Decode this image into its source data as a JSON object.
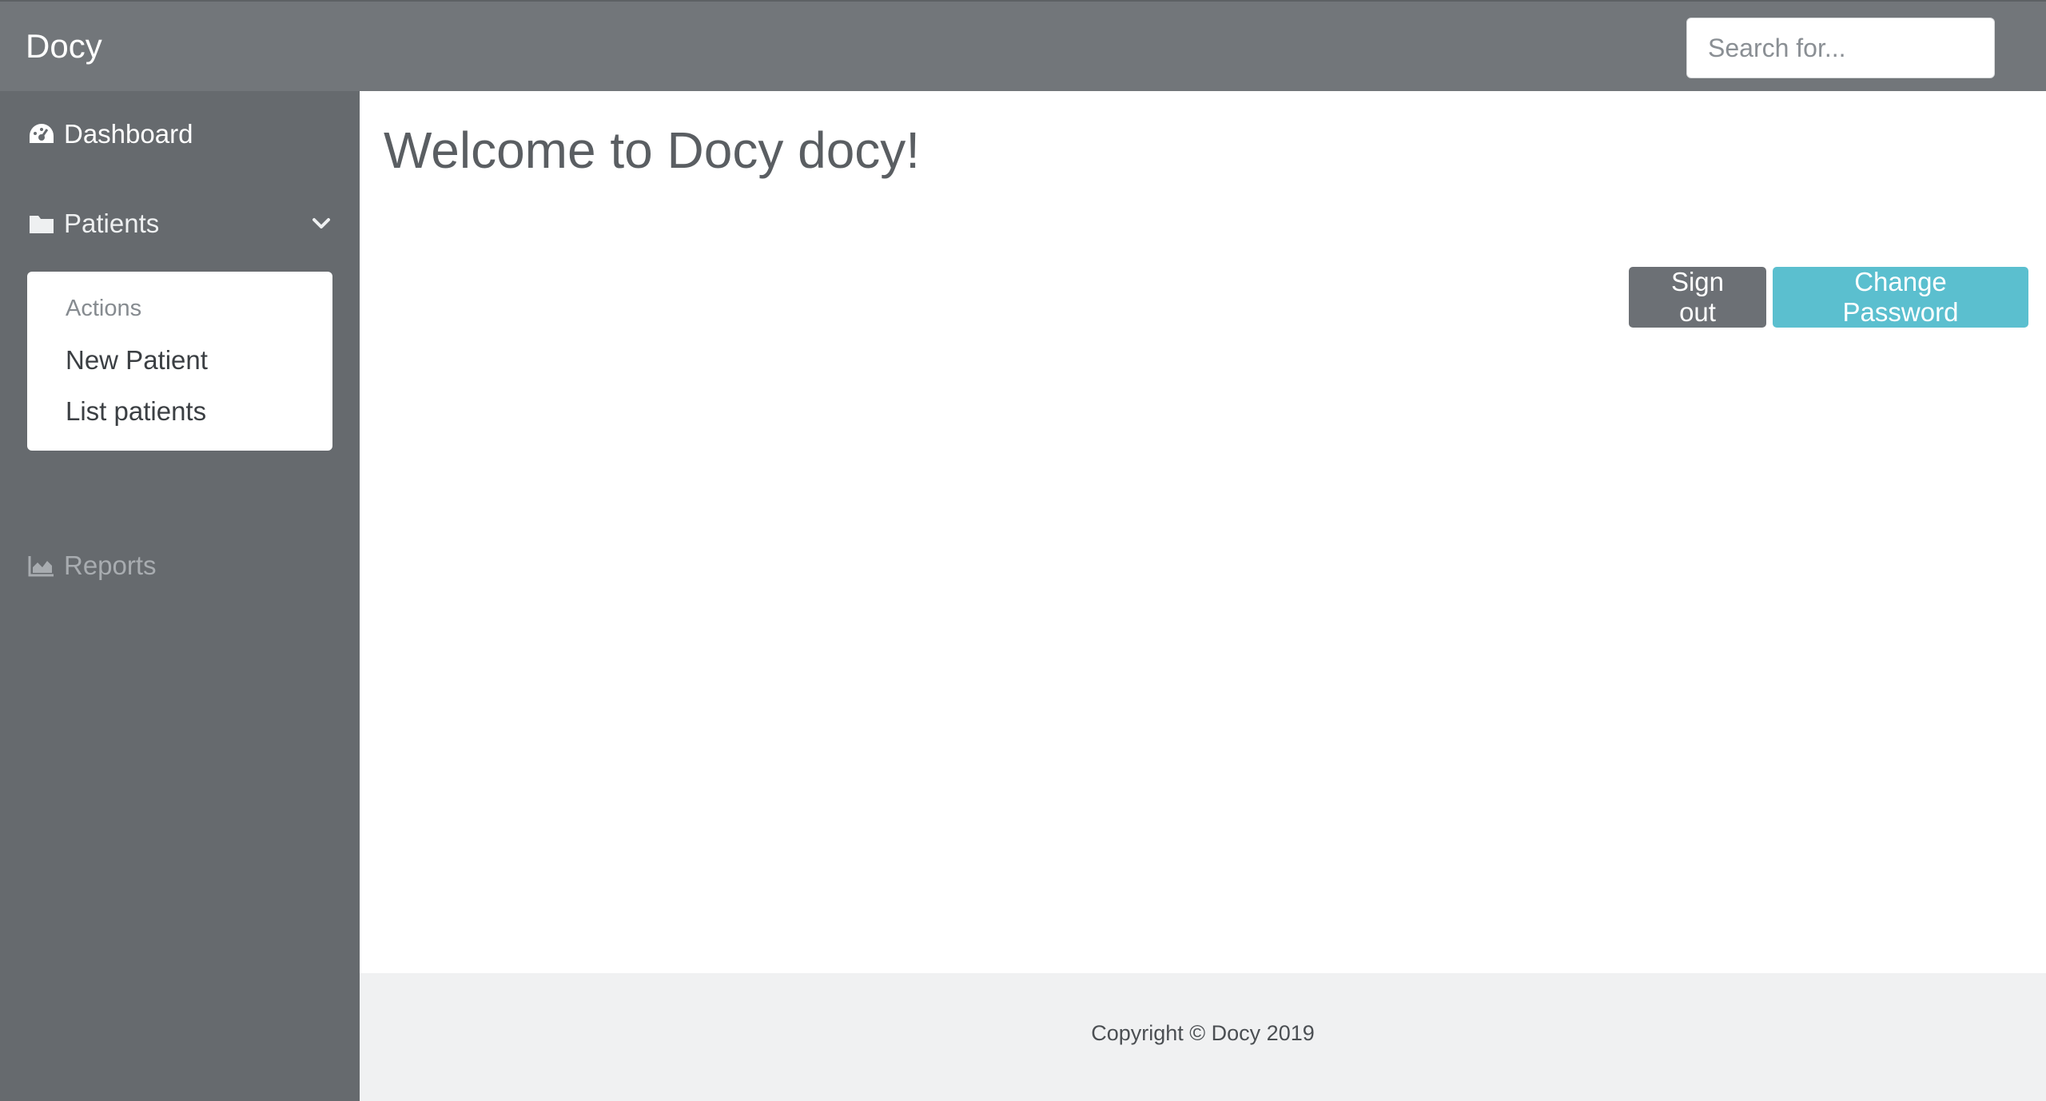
{
  "app": {
    "brand": "Docy"
  },
  "search": {
    "placeholder": "Search for..."
  },
  "sidebar": {
    "items": [
      {
        "label": "Dashboard",
        "icon": "dashboard-icon"
      },
      {
        "label": "Patients",
        "icon": "folder-icon",
        "expanded": true
      },
      {
        "label": "Reports",
        "icon": "area-chart-icon"
      }
    ],
    "patients_menu": {
      "header": "Actions",
      "links": [
        "New Patient",
        "List patients"
      ]
    }
  },
  "main": {
    "title": "Welcome to Docy docy!",
    "buttons": {
      "sign_out": "Sign out",
      "change_password": "Change Password"
    }
  },
  "footer": {
    "copyright": "Copyright © Docy 2019"
  },
  "colors": {
    "topbar": "#72767a",
    "sidebar": "#666a6e",
    "accent": "#5bbfcf",
    "secondary_button": "#6c7075",
    "footer": "#f0f1f2"
  }
}
